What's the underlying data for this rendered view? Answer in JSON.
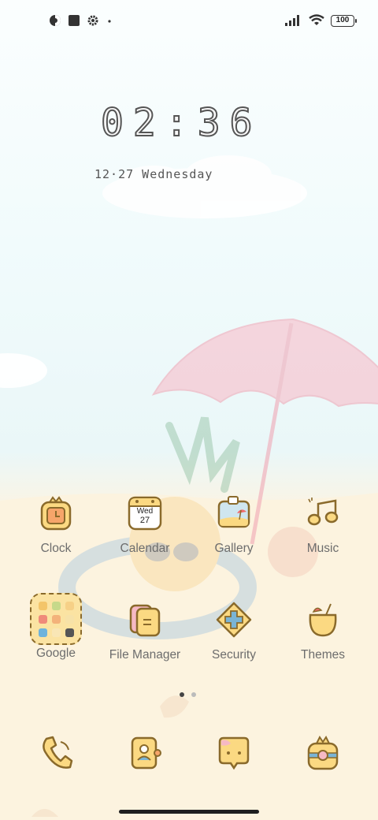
{
  "status_bar": {
    "left_icons": [
      "data-saver-icon",
      "square-notification-icon",
      "settings-gear-icon",
      "dot-icon"
    ],
    "right_icons": [
      "signal-bars-icon",
      "wifi-icon"
    ],
    "battery_level": "100"
  },
  "clock_widget": {
    "time": "02:36",
    "date": "12·27 Wednesday"
  },
  "calendar_icon": {
    "day": "Wed",
    "date": "27"
  },
  "apps": [
    {
      "label": "Clock",
      "icon": "clock-icon"
    },
    {
      "label": "Calendar",
      "icon": "calendar-icon"
    },
    {
      "label": "Gallery",
      "icon": "gallery-icon"
    },
    {
      "label": "Music",
      "icon": "music-icon"
    },
    {
      "label": "Google",
      "icon": "google-folder-icon"
    },
    {
      "label": "File Manager",
      "icon": "file-manager-icon"
    },
    {
      "label": "Security",
      "icon": "security-icon"
    },
    {
      "label": "Themes",
      "icon": "themes-icon"
    }
  ],
  "page_indicator": {
    "pages": 2,
    "current": 1
  },
  "dock": [
    {
      "icon": "phone-icon"
    },
    {
      "icon": "contacts-icon"
    },
    {
      "icon": "messages-icon"
    },
    {
      "icon": "camera-icon"
    }
  ],
  "colors": {
    "icon_fill": "#fbd982",
    "icon_stroke": "#8a6a2b",
    "label": "#6d6d6d"
  }
}
